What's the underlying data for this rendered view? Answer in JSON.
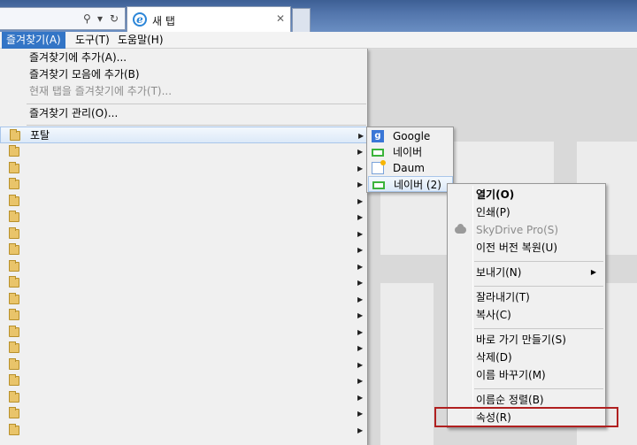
{
  "browser": {
    "address_icons": {
      "search": "⚲",
      "dropdown": "▾",
      "refresh": "↻"
    },
    "tab": {
      "title": "새 탭",
      "close": "✕",
      "favicon": "e"
    }
  },
  "menubar": {
    "items": [
      {
        "label": "즐겨찾기(A)",
        "active": true
      },
      {
        "label": "도구(T)",
        "active": false
      },
      {
        "label": "도움말(H)",
        "active": false
      }
    ]
  },
  "favorites_menu": {
    "add_to_favorites": "즐겨찾기에 추가(A)...",
    "add_to_favorites_bar": "즐겨찾기 모음에 추가(B)",
    "add_current_tabs": "현재 탭을 즐겨찾기에 추가(T)...",
    "organize": "즐겨찾기 관리(O)...",
    "portal_folder": "포탈",
    "arrow": "▶"
  },
  "portal_submenu": {
    "items": [
      {
        "label": "Google",
        "icon": "google-icon"
      },
      {
        "label": "네이버",
        "icon": "naver-icon"
      },
      {
        "label": "Daum",
        "icon": "daum-icon"
      },
      {
        "label": "네이버 (2)",
        "icon": "naver-icon"
      }
    ]
  },
  "context_menu": {
    "open": "열기(O)",
    "print": "인쇄(P)",
    "skydrive": "SkyDrive Pro(S)",
    "restore": "이전 버전 복원(U)",
    "send_to": "보내기(N)",
    "cut": "잘라내기(T)",
    "copy": "복사(C)",
    "create_shortcut": "바로 가기 만들기(S)",
    "delete": "삭제(D)",
    "rename": "이름 바꾸기(M)",
    "sort_by_name": "이름순 정렬(B)",
    "properties": "속성(R)",
    "arrow": "▶"
  },
  "colors": {
    "accent": "#3375c6",
    "highlight_box": "#b02020"
  }
}
